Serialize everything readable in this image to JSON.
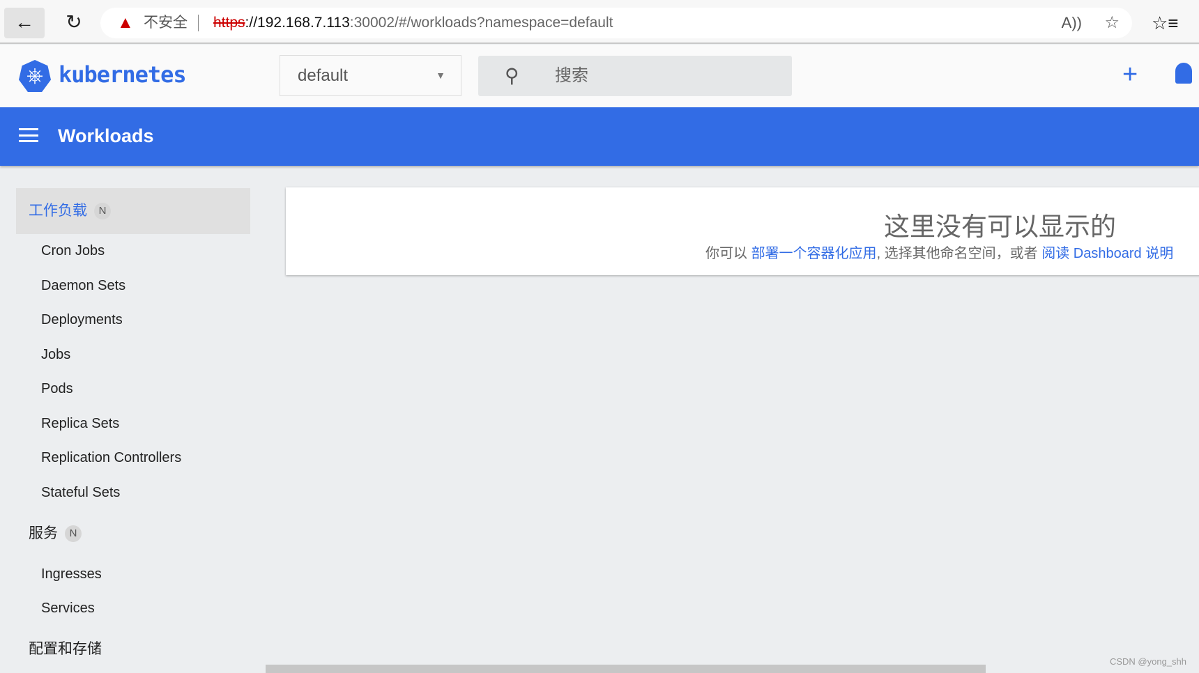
{
  "browser": {
    "insecure_label": "不安全",
    "url_scheme": "https",
    "url_host": "://192.168.7.113",
    "url_rest": ":30002/#/workloads?namespace=default"
  },
  "header": {
    "brand": "kubernetes",
    "namespace": "default",
    "search_placeholder": "搜索"
  },
  "topbar": {
    "title": "Workloads"
  },
  "sidebar": {
    "workloads": {
      "label": "工作负载",
      "badge": "N",
      "items": [
        "Cron Jobs",
        "Daemon Sets",
        "Deployments",
        "Jobs",
        "Pods",
        "Replica Sets",
        "Replication Controllers",
        "Stateful Sets"
      ]
    },
    "services": {
      "label": "服务",
      "badge": "N",
      "items": [
        "Ingresses",
        "Services"
      ]
    },
    "config": {
      "label": "配置和存储"
    }
  },
  "empty": {
    "title": "这里没有可以显示的",
    "prefix": "你可以 ",
    "link1": "部署一个容器化应用",
    "middle": ", 选择其他命名空间，或者 ",
    "link2": "阅读 Dashboard 说明"
  },
  "watermark": "CSDN @yong_shh",
  "colors": {
    "accent": "#326ce5"
  }
}
